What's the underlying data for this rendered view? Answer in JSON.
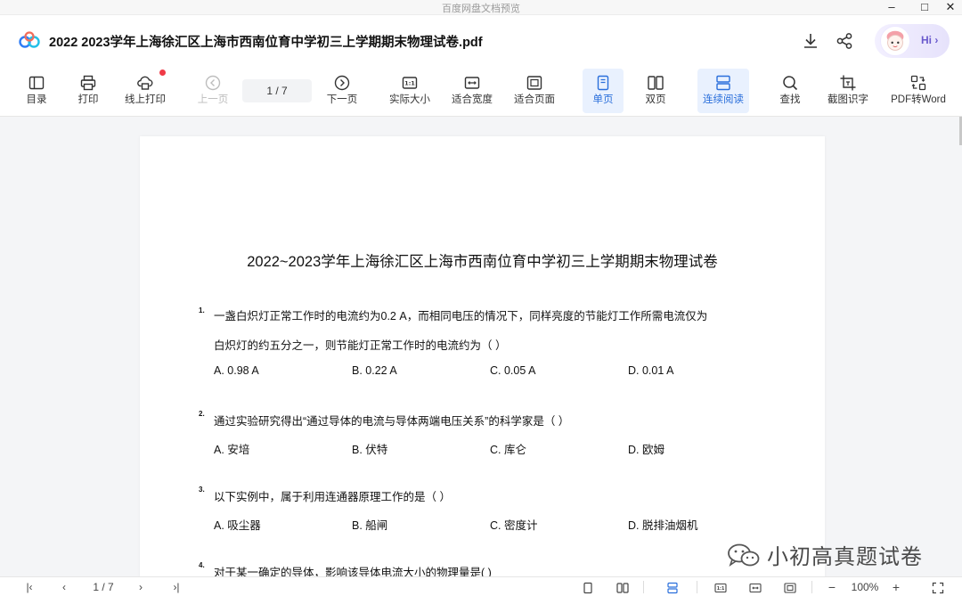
{
  "window": {
    "title": "百度网盘文档预览",
    "controls": {
      "minimize": "–",
      "maximize": "□",
      "close": "✕"
    }
  },
  "header": {
    "filename": "2022  2023学年上海徐汇区上海市西南位育中学初三上学期期末物理试卷.pdf",
    "download_icon": "download-icon",
    "share_icon": "share-icon",
    "assistant": {
      "greeting": "Hi ›"
    }
  },
  "toolbar": {
    "items": [
      {
        "label": "目录",
        "icon": "toc-icon"
      },
      {
        "label": "打印",
        "icon": "printer-icon"
      },
      {
        "label": "线上打印",
        "icon": "cloud-print-icon"
      },
      {
        "label": "上一页",
        "icon": "prev-page-icon",
        "disabled": true
      },
      {
        "label": "下一页",
        "icon": "next-page-icon"
      },
      {
        "label": "实际大小",
        "icon": "actual-size-icon"
      },
      {
        "label": "适合宽度",
        "icon": "fit-width-icon"
      },
      {
        "label": "适合页面",
        "icon": "fit-page-icon"
      },
      {
        "label": "单页",
        "icon": "single-page-icon",
        "active": true
      },
      {
        "label": "双页",
        "icon": "double-page-icon"
      },
      {
        "label": "连续阅读",
        "icon": "continuous-icon",
        "active": true
      },
      {
        "label": "查找",
        "icon": "search-icon"
      },
      {
        "label": "截图识字",
        "icon": "screenshot-ocr-icon"
      },
      {
        "label": "PDF转Word",
        "icon": "pdf-to-word-icon"
      }
    ],
    "page_indicator": "1  / 7",
    "actual_size_glyph": "1:1"
  },
  "document": {
    "title": "2022~2023学年上海徐汇区上海市西南位育中学初三上学期期末物理试卷",
    "questions": [
      {
        "number": "1.",
        "lines": [
          "一盏白炽灯正常工作时的电流约为0.2 A，而相同电压的情况下，同样亮度的节能灯工作所需电流仅为",
          "白炽灯的约五分之一，则节能灯正常工作时的电流约为（    ）"
        ],
        "options": [
          "A. 0.98 A",
          "B. 0.22 A",
          "C. 0.05 A",
          "D. 0.01 A"
        ]
      },
      {
        "number": "2.",
        "lines": [
          "通过实验研究得出“通过导体的电流与导体两端电压关系”的科学家是（    ）"
        ],
        "options": [
          "A. 安培",
          "B. 伏特",
          "C. 库仑",
          "D. 欧姆"
        ]
      },
      {
        "number": "3.",
        "lines": [
          "以下实例中，属于利用连通器原理工作的是（    ）"
        ],
        "options": [
          "A. 吸尘器",
          "B. 船闸",
          "C. 密度计",
          "D. 脱排油烟机"
        ]
      },
      {
        "number": "4.",
        "lines": [
          "对于某一确定的导体，影响该导体电流大小的物理量是(      )"
        ],
        "options": []
      }
    ]
  },
  "watermark": {
    "text": "小初高真题试卷",
    "icon": "wechat-icon"
  },
  "bottombar": {
    "page_indicator": "1 / 7",
    "zoom": "100%",
    "first_glyph": "|‹",
    "prev_glyph": "‹",
    "next_glyph": "›",
    "last_glyph": "›|",
    "minus_glyph": "−",
    "plus_glyph": "+",
    "actual_size_glyph": "1:1"
  }
}
